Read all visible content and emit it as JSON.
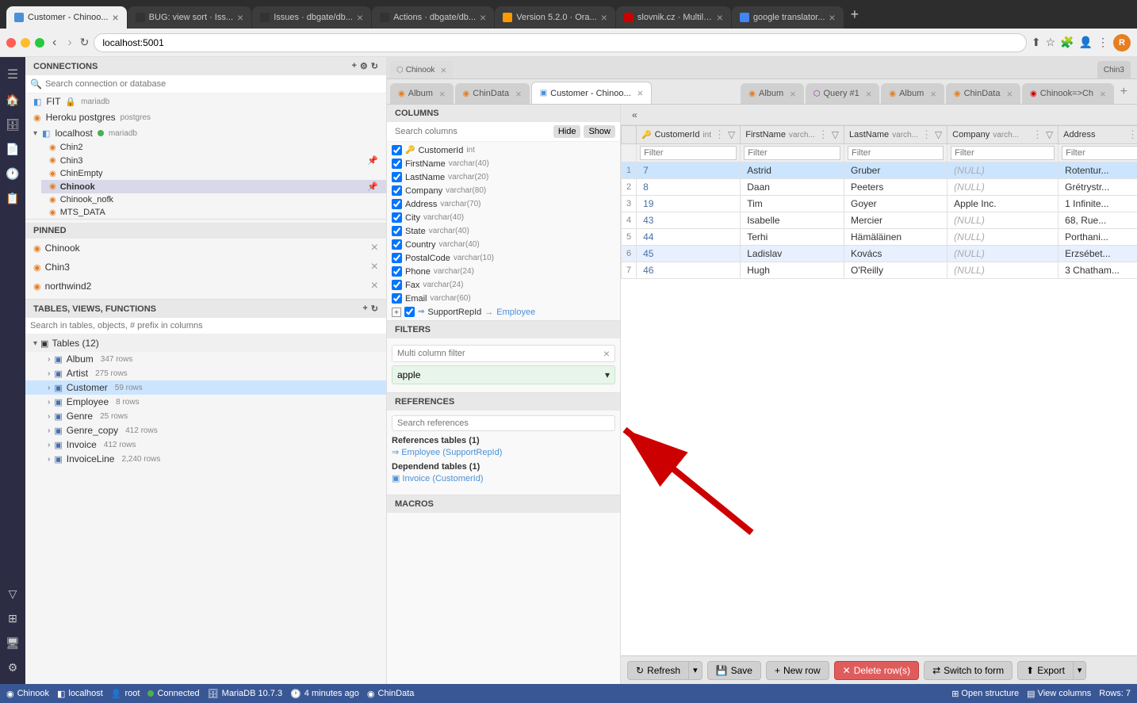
{
  "browser": {
    "url": "localhost:5001",
    "tabs": [
      {
        "id": "tab1",
        "title": "Customer - Chinoo...",
        "favicon_color": "#4a90d9",
        "active": true
      },
      {
        "id": "tab2",
        "title": "BUG: view sort · Iss...",
        "favicon_color": "#333"
      },
      {
        "id": "tab3",
        "title": "Issues · dbgate/db...",
        "favicon_color": "#333"
      },
      {
        "id": "tab4",
        "title": "Actions · dbgate/db...",
        "favicon_color": "#333"
      },
      {
        "id": "tab5",
        "title": "Version 5.2.0 · Ora...",
        "favicon_color": "#f90"
      },
      {
        "id": "tab6",
        "title": "slovnik.cz · Multilin...",
        "favicon_color": "#c00"
      },
      {
        "id": "tab7",
        "title": "google translator...",
        "favicon_color": "#4285f4"
      }
    ]
  },
  "connections_header": "CONNECTIONS",
  "connections_search_placeholder": "Search connection or database",
  "connections": [
    {
      "name": "FIT",
      "type": "mariadb",
      "icon": "🔑",
      "locked": true
    },
    {
      "name": "Heroku postgres",
      "type": "postgres",
      "icon": "🟠"
    },
    {
      "name": "localhost",
      "type": "mariadb",
      "connected": true,
      "expanded": true
    }
  ],
  "localhost_children": [
    {
      "name": "Chin2"
    },
    {
      "name": "Chin3",
      "pinned": true
    },
    {
      "name": "ChinEmpty"
    },
    {
      "name": "Chinook",
      "bold": true,
      "pinned": true
    },
    {
      "name": "Chinook_nofk"
    },
    {
      "name": "MTS_DATA"
    }
  ],
  "pinned_header": "PINNED",
  "pinned_items": [
    {
      "name": "Chinook"
    },
    {
      "name": "Chin3"
    },
    {
      "name": "northwind2"
    }
  ],
  "tables_header": "TABLES, VIEWS, FUNCTIONS",
  "tables_search_placeholder": "Search in tables, objects, # prefix in columns",
  "table_group_label": "Tables (12)",
  "tables": [
    {
      "name": "Album",
      "count": "347 rows"
    },
    {
      "name": "Artist",
      "count": "275 rows"
    },
    {
      "name": "Customer",
      "count": "59 rows",
      "selected": true
    },
    {
      "name": "Employee",
      "count": "8 rows"
    },
    {
      "name": "Genre",
      "count": "25 rows"
    },
    {
      "name": "Genre_copy",
      "count": "412 rows"
    },
    {
      "name": "Invoice",
      "count": "412 rows"
    },
    {
      "name": "InvoiceLine",
      "count": "2,240 rows"
    }
  ],
  "app_tabs": {
    "first_row": [
      {
        "label": "Album",
        "icon": "orange",
        "active": false
      },
      {
        "label": "ChinData",
        "icon": "orange",
        "active": false
      },
      {
        "label": "Customer",
        "icon": "blue",
        "active": true
      }
    ],
    "second_row": [
      {
        "label": "Chinook",
        "icon": "orange"
      },
      {
        "label": "Album",
        "icon": "orange"
      },
      {
        "label": "Query #1",
        "icon": "query"
      },
      {
        "label": "Album",
        "icon": "orange"
      },
      {
        "label": "ChinData",
        "icon": "orange"
      },
      {
        "label": "Chinook=>Ch",
        "icon": "orange"
      }
    ]
  },
  "columns_section_header": "COLUMNS",
  "search_columns_placeholder": "Search columns",
  "hide_label": "Hide",
  "show_label": "Show",
  "columns": [
    {
      "name": "CustomerId",
      "type": "int",
      "checked": true,
      "pk": true
    },
    {
      "name": "FirstName",
      "type": "varchar(40)",
      "checked": true
    },
    {
      "name": "LastName",
      "type": "varchar(20)",
      "checked": true
    },
    {
      "name": "Company",
      "type": "varchar(80)",
      "checked": true
    },
    {
      "name": "Address",
      "type": "varchar(70)",
      "checked": true
    },
    {
      "name": "City",
      "type": "varchar(40)",
      "checked": true
    },
    {
      "name": "State",
      "type": "varchar(40)",
      "checked": true
    },
    {
      "name": "Country",
      "type": "varchar(40)",
      "checked": true
    },
    {
      "name": "PostalCode",
      "type": "varchar(10)",
      "checked": true
    },
    {
      "name": "Phone",
      "type": "varchar(24)",
      "checked": true
    },
    {
      "name": "Fax",
      "type": "varchar(24)",
      "checked": true
    },
    {
      "name": "Email",
      "type": "varchar(60)",
      "checked": true
    },
    {
      "name": "SupportRepId",
      "type": "",
      "checked": true,
      "ref": "Employee",
      "is_ref": true
    }
  ],
  "filters_header": "FILTERS",
  "filter_placeholder": "Multi column filter",
  "filter_value": "apple",
  "references_header": "REFERENCES",
  "references_search_placeholder": "Search references",
  "ref_tables_label": "References tables (1)",
  "ref_employee": "Employee (SupportRepId)",
  "ref_dep_label": "Dependend tables (1)",
  "ref_invoice": "Invoice (CustomerId)",
  "macros_header": "MACROS",
  "table_columns": [
    {
      "label": "CustomerId int",
      "type": "int"
    },
    {
      "label": "FirstName varch...",
      "type": "varchar"
    },
    {
      "label": "LastName varch...",
      "type": "varchar"
    },
    {
      "label": "Company varch...",
      "type": "varchar"
    },
    {
      "label": "Address",
      "type": "varchar"
    }
  ],
  "table_rows": [
    {
      "num": "1",
      "customerId": "7",
      "firstName": "Astrid",
      "lastName": "Gruber",
      "company": "(NULL)",
      "address": "Rotentur...",
      "selected": true
    },
    {
      "num": "2",
      "customerId": "8",
      "firstName": "Daan",
      "lastName": "Peeters",
      "company": "(NULL)",
      "address": "Grétrystr..."
    },
    {
      "num": "3",
      "customerId": "19",
      "firstName": "Tim",
      "lastName": "Goyer",
      "company": "Apple Inc.",
      "address": "1 Infinite..."
    },
    {
      "num": "4",
      "customerId": "43",
      "firstName": "Isabelle",
      "lastName": "Mercier",
      "company": "(NULL)",
      "address": "68, Rue..."
    },
    {
      "num": "5",
      "customerId": "44",
      "firstName": "Terhi",
      "lastName": "Hämäläinen",
      "company": "(NULL)",
      "address": "Porthani..."
    },
    {
      "num": "6",
      "customerId": "45",
      "firstName": "Ladislav",
      "lastName": "Kovács",
      "company": "(NULL)",
      "address": "Erzsébet..."
    },
    {
      "num": "7",
      "customerId": "46",
      "firstName": "Hugh",
      "lastName": "O'Reilly",
      "company": "(NULL)",
      "address": "3 Chatham..."
    }
  ],
  "toolbar_buttons": {
    "refresh": "Refresh",
    "save": "Save",
    "new_row": "New row",
    "delete_row": "Delete row(s)",
    "switch_form": "Switch to form",
    "export": "Export"
  },
  "status_items": [
    {
      "label": "Chinook"
    },
    {
      "label": "localhost"
    },
    {
      "label": "root"
    },
    {
      "label": "Connected"
    },
    {
      "label": "MariaDB 10.7.3"
    },
    {
      "label": "4 minutes ago"
    },
    {
      "label": "ChinData"
    }
  ],
  "right_status": {
    "open_structure": "Open structure",
    "view_columns": "View columns",
    "rows": "Rows: 7"
  }
}
